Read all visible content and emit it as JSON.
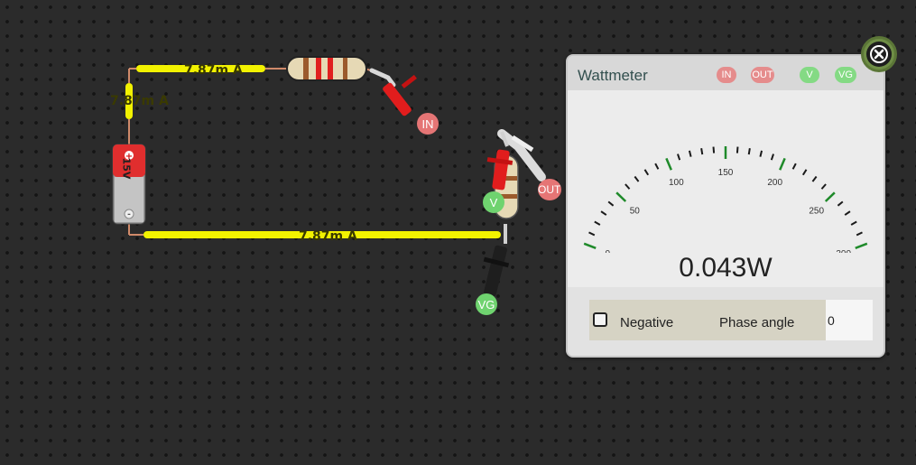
{
  "circuit": {
    "wire_labels": [
      "7.87m A",
      "7.87m A",
      "7.87m A"
    ],
    "battery_label": "15V"
  },
  "probes": {
    "in": "IN",
    "out": "OUT",
    "v": "V",
    "vg": "VG"
  },
  "wattmeter": {
    "title": "Wattmeter",
    "terminals": [
      "IN",
      "OUT",
      "V",
      "VG"
    ],
    "scale_labels": [
      "0",
      "50",
      "100",
      "150",
      "200",
      "250",
      "300"
    ],
    "scale_max": 300,
    "reading": "0.043W",
    "negative_label": "Negative",
    "negative_checked": false,
    "phase_label": "Phase angle",
    "phase_value": "0"
  },
  "colors": {
    "wire": "#f2f200",
    "probe_red": "#e57575",
    "probe_green": "#6fd36f",
    "gauge_tick": "#1f8a2a",
    "close_button": "#6f8e46"
  },
  "icons": {
    "close": "close-icon",
    "battery": "battery-icon",
    "resistor": "resistor-icon"
  }
}
